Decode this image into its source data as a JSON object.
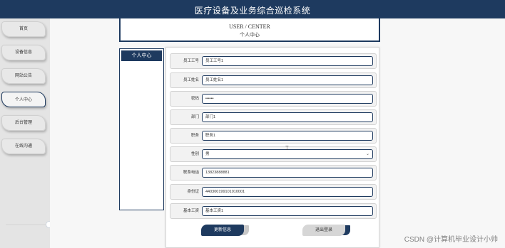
{
  "app": {
    "title": "医疗设备及业务综合巡检系统"
  },
  "sidebar": {
    "items": [
      {
        "label": "首页"
      },
      {
        "label": "设备信息"
      },
      {
        "label": "网站公告"
      },
      {
        "label": "个人中心",
        "active": true
      },
      {
        "label": "后台管理"
      },
      {
        "label": "在线沟通"
      }
    ]
  },
  "header": {
    "en": "USER / CENTER",
    "cn": "个人中心"
  },
  "left_panel": {
    "tab_label": "个人中心"
  },
  "form": {
    "fields": [
      {
        "label": "员工工号",
        "value": "员工工号1"
      },
      {
        "label": "员工姓名",
        "value": "员工姓名1"
      },
      {
        "label": "密码",
        "value": "••••••"
      },
      {
        "label": "部门",
        "value": "部门1"
      },
      {
        "label": "职务",
        "value": "职务1"
      },
      {
        "label": "性别",
        "value": "男",
        "type": "select"
      },
      {
        "label": "联系电话",
        "value": "13823888881"
      },
      {
        "label": "身份证",
        "value": "440300199101010001"
      },
      {
        "label": "基本工资",
        "value": "基本工资1"
      }
    ],
    "update_button": "更新信息",
    "logout_button": "退出登录"
  },
  "watermark": "CSDN @计算机毕业设计小帅",
  "colors": {
    "primary": "#1e3a5f",
    "background": "#f7f7f7"
  }
}
